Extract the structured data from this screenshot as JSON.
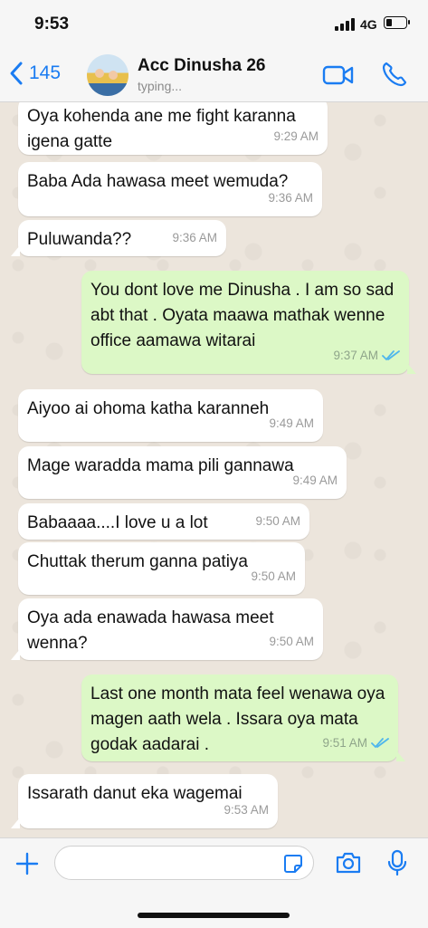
{
  "status_bar": {
    "time": "9:53",
    "network": "4G",
    "battery_level": 0.3
  },
  "header": {
    "back_count": "145",
    "contact_name": "Acc Dinusha 26",
    "contact_status": "typing..."
  },
  "messages": [
    {
      "direction": "in",
      "text": "Oya kohenda ane me fight karanna igena gatte",
      "time": "9:29 AM"
    },
    {
      "direction": "in",
      "text": "Baba Ada hawasa meet wemuda?",
      "time": "9:36 AM"
    },
    {
      "direction": "in",
      "text": "Puluwanda??",
      "time": "9:36 AM"
    },
    {
      "direction": "out",
      "text": "You dont love me Dinusha . I am so sad abt that . Oyata maawa mathak wenne office aamawa witarai",
      "time": "9:37 AM",
      "status": "read"
    },
    {
      "direction": "in",
      "text": "Aiyoo ai ohoma katha karanneh",
      "time": "9:49 AM"
    },
    {
      "direction": "in",
      "text": "Mage waradda mama pili gannawa",
      "time": "9:49 AM"
    },
    {
      "direction": "in",
      "text": "Babaaaa....I love u a lot",
      "time": "9:50 AM"
    },
    {
      "direction": "in",
      "text": "Chuttak therum ganna patiya",
      "time": "9:50 AM"
    },
    {
      "direction": "in",
      "text": "Oya ada enawada hawasa meet wenna?",
      "time": "9:50 AM"
    },
    {
      "direction": "out",
      "text": "Last one month mata feel wenawa oya magen aath wela . Issara oya mata godak aadarai .",
      "time": "9:51 AM",
      "status": "read"
    },
    {
      "direction": "in",
      "text": "Issarath danut eka wagemai",
      "time": "9:53 AM"
    }
  ],
  "input": {
    "placeholder": ""
  },
  "colors": {
    "accent": "#1a7cf2",
    "outgoing_bubble": "#dcf8c6",
    "incoming_bubble": "#ffffff",
    "read_tick": "#4fb6ec",
    "chat_background": "#ece5dc"
  },
  "icons": [
    "back-chevron-icon",
    "video-call-icon",
    "phone-icon",
    "plus-icon",
    "sticker-icon",
    "camera-icon",
    "microphone-icon",
    "read-ticks-icon"
  ]
}
